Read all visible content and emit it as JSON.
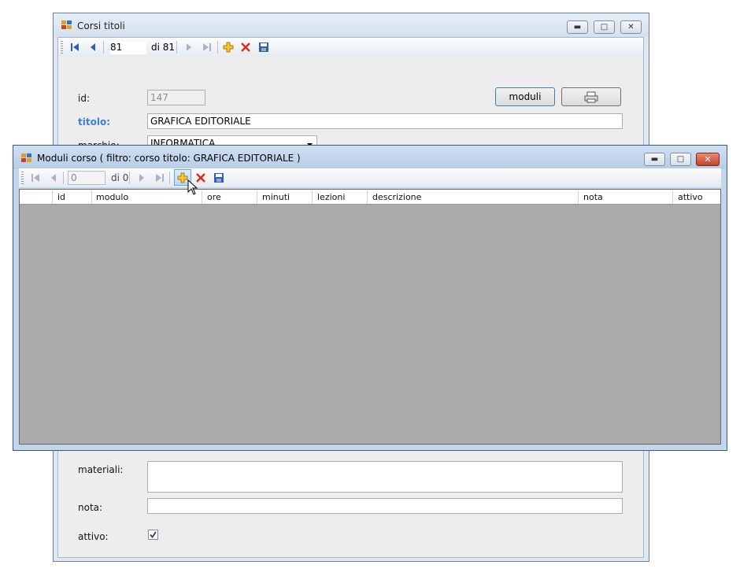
{
  "back_window": {
    "title": "Corsi titoli",
    "nav": {
      "position": "81",
      "count": "di 81"
    },
    "form": {
      "id_label": "id:",
      "id_value": "147",
      "titolo_label": "titolo:",
      "titolo_value": "GRAFICA EDITORIALE",
      "marchio_label": "marchio:",
      "marchio_value": "INFORMATICA",
      "moduli_button": "moduli",
      "materiali_label": "materiali:",
      "nota_label": "nota:",
      "attivo_label": "attivo:",
      "attivo_checked": true
    }
  },
  "front_window": {
    "title": "Moduli corso ( filtro: corso titolo: GRAFICA EDITORIALE )",
    "nav": {
      "position": "0",
      "count": "di 0"
    },
    "grid": {
      "columns": [
        "id",
        "modulo",
        "ore",
        "minuti",
        "lezioni",
        "descrizione",
        "nota",
        "attivo"
      ]
    }
  },
  "colors": {
    "accent_label": "#3c7fd8",
    "grid_bg": "#ababab"
  }
}
